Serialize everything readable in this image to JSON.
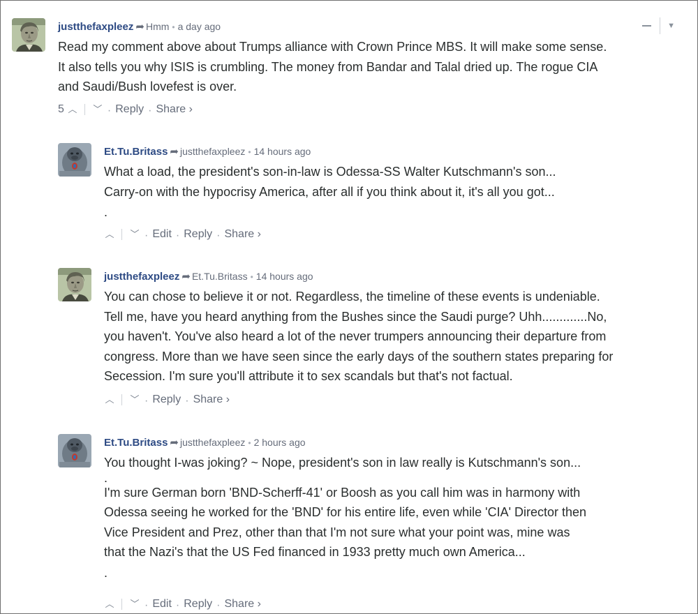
{
  "controls": {
    "collapse_icon": "minus-icon",
    "menu_icon": "caret-down-icon"
  },
  "comments": [
    {
      "author": "justthefaxpleez",
      "reply_to": "Hmm",
      "time": "a day ago",
      "avatar": "portrait-avatar",
      "paragraphs": [
        "Read my comment above about Trumps alliance with Crown Prince MBS. It will make some sense.",
        "It also tells you why ISIS is crumbling. The money from Bandar and Talal dried up. The rogue CIA",
        "and Saudi/Bush lovefest is over."
      ],
      "vote_count": "5",
      "actions": [
        "Reply",
        "Share ›"
      ]
    },
    {
      "author": "Et.Tu.Britass",
      "reply_to": "justthefaxpleez",
      "time": "14 hours ago",
      "avatar": "gorilla-avatar",
      "paragraphs": [
        "What a load, the president's son-in-law is Odessa-SS Walter Kutschmann's son...",
        "Carry-on with the hypocrisy America, after all if you think about it, it's all you got...",
        "",
        "."
      ],
      "actions": [
        "Edit",
        "Reply",
        "Share ›"
      ]
    },
    {
      "author": "justthefaxpleez",
      "reply_to": "Et.Tu.Britass",
      "time": "14 hours ago",
      "avatar": "portrait-avatar",
      "paragraphs": [
        "You can chose to believe it or not. Regardless, the timeline of these events is undeniable.",
        "Tell me, have you heard anything from the Bushes since the Saudi purge? Uhh.............No,",
        "you haven't. You've also heard a lot of the never trumpers announcing their departure from",
        "congress. More than we have seen since the early days of the southern states preparing for",
        "Secession. I'm sure you'll attribute it to sex scandals but that's not factual."
      ],
      "actions": [
        "Reply",
        "Share ›"
      ]
    },
    {
      "author": "Et.Tu.Britass",
      "reply_to": "justthefaxpleez",
      "time": "2 hours ago",
      "avatar": "gorilla-avatar",
      "paragraphs": [
        "You thought I-was joking? ~ Nope, president's son in law really is Kutschmann's son...",
        ".",
        "I'm sure German born 'BND-Scherff-41' or Boosh as you call him was in harmony with",
        "Odessa seeing he worked for the 'BND' for his entire life, even while 'CIA' Director then",
        "Vice President and Prez, other than that I'm not sure what your point was, mine was",
        "that the Nazi's that the US Fed financed in 1933 pretty much own America...",
        "",
        "."
      ],
      "actions": [
        "Edit",
        "Reply",
        "Share ›"
      ]
    }
  ]
}
